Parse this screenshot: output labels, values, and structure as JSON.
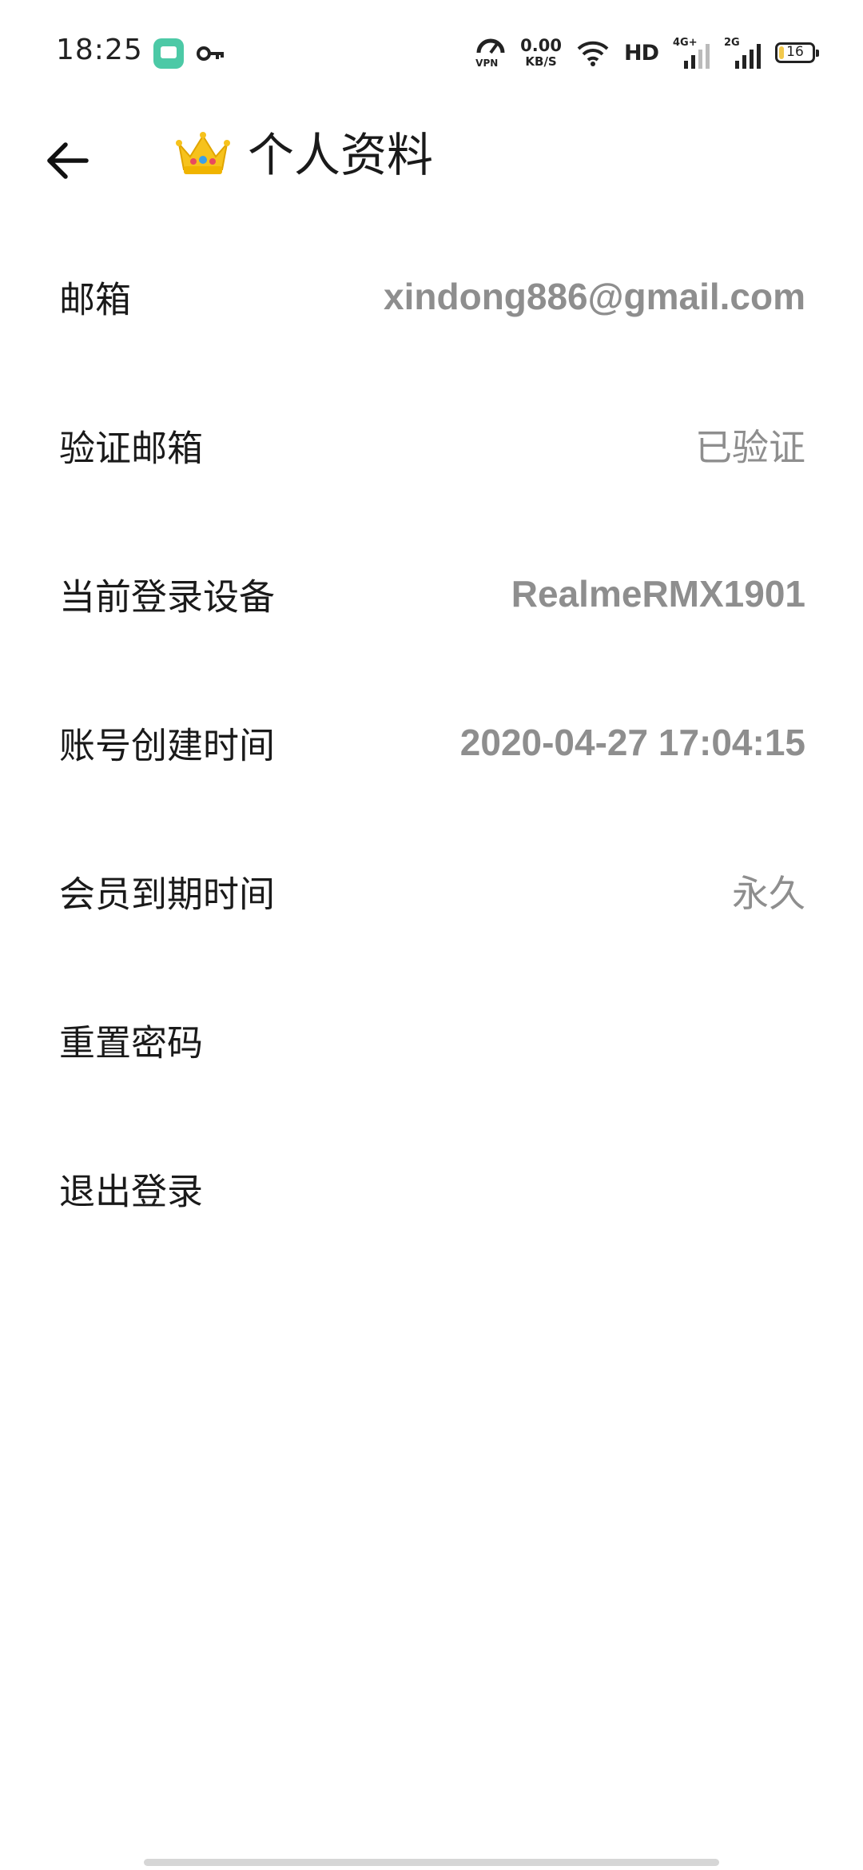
{
  "status_bar": {
    "time": "18:25",
    "vpn_label": "VPN",
    "net_speed_value": "0.00",
    "net_speed_unit": "KB/S",
    "hd_label": "HD",
    "signal_1_label": "4G+",
    "signal_2_label": "2G",
    "battery_level": "16",
    "battery_fraction": 0.16
  },
  "header": {
    "title": "个人资料",
    "title_icon": "crown-icon",
    "back_icon": "arrow-left-icon"
  },
  "profile_rows": [
    {
      "label": "邮箱",
      "value": "xindong886@gmail.com"
    },
    {
      "label": "验证邮箱",
      "value": "已验证"
    },
    {
      "label": "当前登录设备",
      "value": "RealmeRMX1901"
    },
    {
      "label": "账号创建时间",
      "value": "2020-04-27 17:04:15"
    },
    {
      "label": "会员到期时间",
      "value": "永久"
    },
    {
      "label": "重置密码",
      "value": ""
    },
    {
      "label": "退出登录",
      "value": ""
    }
  ],
  "colors": {
    "label_text": "#1a1a1a",
    "value_text": "#8e8e8e",
    "background": "#ffffff"
  }
}
